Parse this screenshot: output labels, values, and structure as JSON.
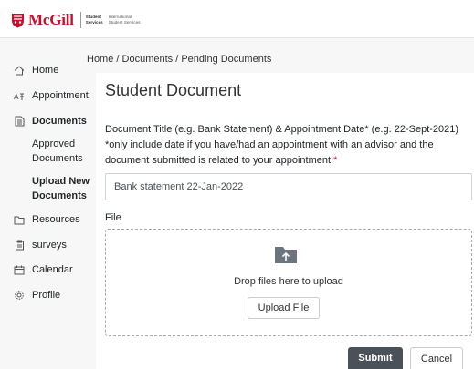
{
  "header": {
    "brand": "McGill",
    "sub_line1": "Student",
    "sub_line2": "Services",
    "sub_line3": "International",
    "sub_line4": "Student Services",
    "brand_color": "#c8102e"
  },
  "sidebar": {
    "items": [
      {
        "label": "Home",
        "icon": "home-icon"
      },
      {
        "label": "Appointment",
        "icon": "appointment-icon"
      },
      {
        "label": "Documents",
        "icon": "document-icon"
      },
      {
        "label": "Resources",
        "icon": "folder-icon"
      },
      {
        "label": "surveys",
        "icon": "clipboard-icon"
      },
      {
        "label": "Calendar",
        "icon": "calendar-icon"
      },
      {
        "label": "Profile",
        "icon": "gear-icon"
      }
    ],
    "sub_items": [
      {
        "label": "Approved Documents"
      },
      {
        "label": "Upload New Documents"
      }
    ]
  },
  "breadcrumb": "Home / Documents / Pending Documents",
  "main": {
    "title": "Student Document",
    "field_label": "Document Title (e.g. Bank Statement) & Appointment Date* (e.g. 22-Sept-2021) *only include date if you have/had an appointment with an advisor and the document submitted is related to your appointment",
    "required_mark": "*",
    "input_value": "Bank statement 22-Jan-2022",
    "file_label": "File",
    "drop_text": "Drop files here to upload",
    "upload_label": "Upload File",
    "submit_label": "Submit",
    "cancel_label": "Cancel"
  }
}
